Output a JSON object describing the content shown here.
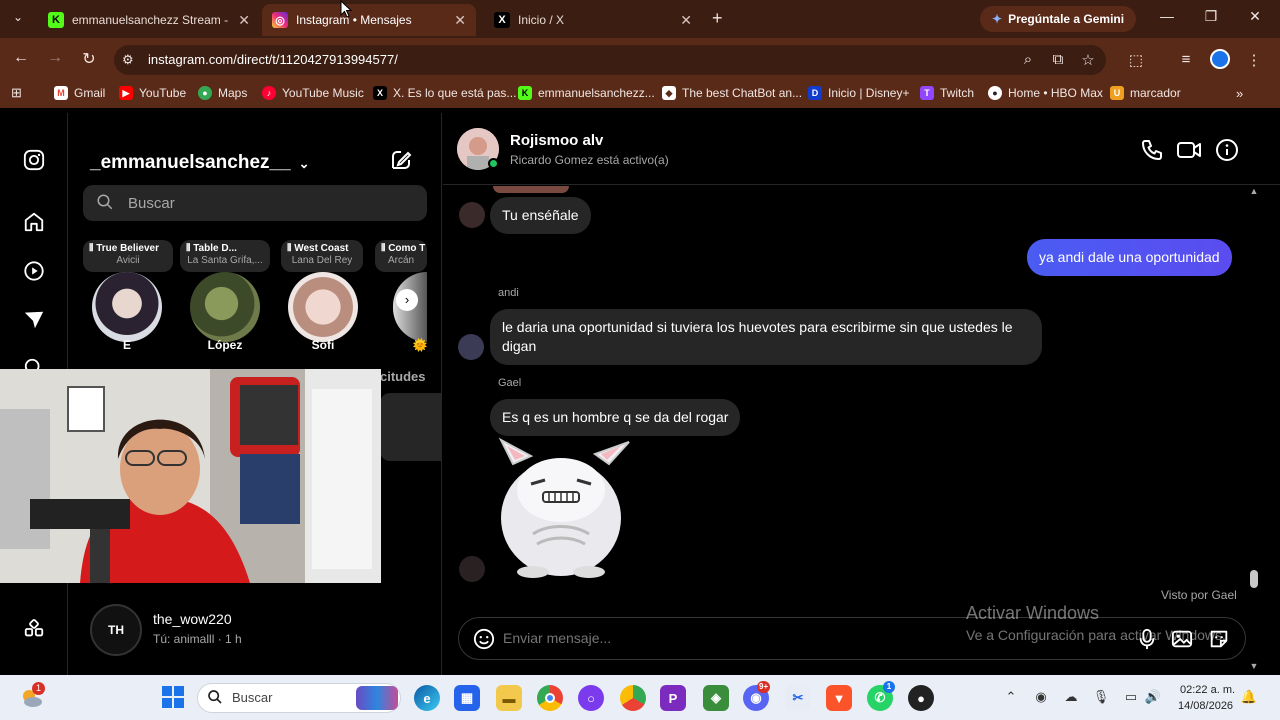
{
  "browser": {
    "tabs": [
      {
        "title": "emmanuelsanchezz Stream - W",
        "icon": "kick-icon",
        "color": "#53fc18",
        "glyph": "K"
      },
      {
        "title": "Instagram • Mensajes",
        "icon": "instagram-icon",
        "color": "#d62976",
        "glyph": "◎"
      },
      {
        "title": "Inicio / X",
        "icon": "x-icon",
        "color": "#000000",
        "glyph": "X"
      }
    ],
    "new_tab": "+",
    "gemini_label": "Pregúntale a Gemini",
    "url": "instagram.com/direct/t/1120427913994577/",
    "bookmarks": [
      {
        "label": "Gmail",
        "glyph": "M",
        "color": "#ea4335"
      },
      {
        "label": "YouTube",
        "glyph": "▶",
        "color": "#ff0000"
      },
      {
        "label": "Maps",
        "glyph": "●",
        "color": "#34a853"
      },
      {
        "label": "YouTube Music",
        "glyph": "♪",
        "color": "#ff0033"
      },
      {
        "label": "X. Es lo que está pas...",
        "glyph": "X",
        "color": "#000000"
      },
      {
        "label": "emmanuelsanchezz...",
        "glyph": "K",
        "color": "#53fc18"
      },
      {
        "label": "The best ChatBot an...",
        "glyph": "◆",
        "color": "#5a2a19"
      },
      {
        "label": "Inicio | Disney+",
        "glyph": "D",
        "color": "#113ccf"
      },
      {
        "label": "Twitch",
        "glyph": "T",
        "color": "#9146ff"
      },
      {
        "label": "Home • HBO Max",
        "glyph": "●",
        "color": "#222222"
      },
      {
        "label": "marcador",
        "glyph": "U",
        "color": "#f0a020"
      }
    ]
  },
  "instagram": {
    "username": "_emmanuelsanchez__",
    "search_placeholder": "Buscar",
    "notes": [
      {
        "song": "True Believer",
        "artist": "Avicii"
      },
      {
        "song": "Table D...",
        "artist": "La Santa Grifa,..."
      },
      {
        "song": "West Coast",
        "artist": "Lana Del Rey"
      },
      {
        "song": "Como T",
        "artist": "Arcán"
      }
    ],
    "stories": [
      "E",
      "López",
      "Sofi",
      "🌞"
    ],
    "requests_label": "citudes",
    "conversation": {
      "name": "the_wow220",
      "subtitle": "Tú: animalll · 1 h",
      "avatar_text": "TH"
    },
    "chat": {
      "peer_name": "Rojismoo alv",
      "peer_status": "Ricardo Gomez está activo(a)",
      "messages": [
        {
          "text": "Tu enséñale",
          "direction": "in"
        },
        {
          "text": "ya andi dale una oportunidad",
          "direction": "out"
        },
        {
          "sender": "andi",
          "text": "le daria una oportunidad si tuviera los huevotes para escribirme sin que ustedes le digan",
          "direction": "in"
        },
        {
          "sender": "Gael",
          "text": "Es q es un hombre q se da del rogar",
          "direction": "in"
        }
      ],
      "seen": "Visto por Gael",
      "composer_placeholder": "Enviar mensaje..."
    }
  },
  "watermark": {
    "line1": "Activar Windows",
    "line2": "Ve a Configuración para activar Windows."
  },
  "taskbar": {
    "search_placeholder": "Buscar",
    "time": "02:22 a. m.",
    "date": "14/08/2026",
    "badges": {
      "weather": "1",
      "discord": "9+",
      "whatsapp": "1"
    }
  }
}
